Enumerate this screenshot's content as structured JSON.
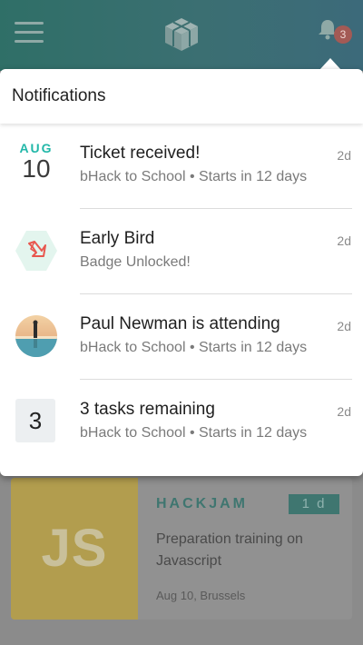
{
  "header": {
    "menu_icon": "hamburger-menu-icon",
    "logo_icon": "cube-logo-icon",
    "bell_icon": "bell-icon",
    "notification_count": "3"
  },
  "notifications": {
    "title": "Notifications",
    "items": [
      {
        "icon": "date",
        "month": "AUG",
        "day": "10",
        "title": "Ticket received!",
        "subtitle": "bHack to School • Starts in 12 days",
        "time": "2d"
      },
      {
        "icon": "origami-bird-badge-icon",
        "title": "Early Bird",
        "subtitle": "Badge Unlocked!",
        "time": "2d"
      },
      {
        "icon": "user-avatar",
        "title": "Paul Newman is attending",
        "subtitle": "bHack to School • Starts in 12 days",
        "time": "2d"
      },
      {
        "icon": "task-count",
        "count": "3",
        "title": "3 tasks remaining",
        "subtitle": "bHack to School • Starts in 12 days",
        "time": "2d"
      }
    ]
  },
  "event_card": {
    "thumb_text": "JS",
    "tag": "HACKJAM",
    "duration": "1 d",
    "title": "Preparation training on Javascript",
    "meta": "Aug 10, Brussels"
  },
  "colors": {
    "accent": "#21b7a8",
    "badge": "#e0554c",
    "header_gradient_start": "#3a8c7f",
    "header_gradient_end": "#4a8495"
  }
}
